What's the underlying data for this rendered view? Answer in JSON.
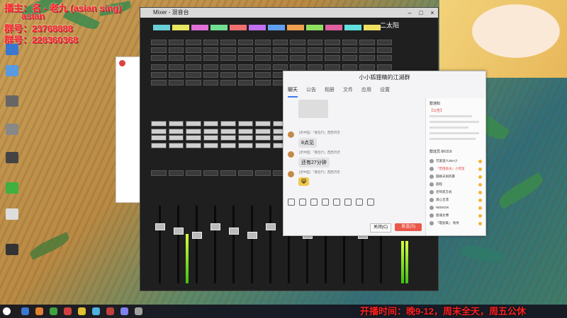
{
  "overlay": {
    "line1": "播主：名 - 老九 (asian sing)",
    "line2": "asian",
    "line3": "群号：23768888",
    "line4": "群号：228360368",
    "bottom": "开播时间：晚9-12，周末全天，周五公休"
  },
  "mixer": {
    "title": "Mixer - 混音台",
    "window_label": "二太阳",
    "tab_colors": [
      "#6ad0d8",
      "#e8e860",
      "#e070d8",
      "#70e090",
      "#f07070",
      "#c070f0",
      "#60a0f0",
      "#f0a050",
      "#90e060",
      "#e060a0",
      "#60e0e0",
      "#f0e060"
    ]
  },
  "chat": {
    "title": "小小狐狸精的江湖群",
    "tabs": [
      "聊天",
      "公告",
      "相册",
      "文件",
      "应用",
      "设置"
    ],
    "messages": [
      {
        "name": "[老中医] 「重俭行」西西河老",
        "text": "8点见"
      },
      {
        "name": "[老中医] 「重俭行」西西河老",
        "text": "还有27分钟"
      },
      {
        "name": "[老中医] 「重俭行」西西河老",
        "text": "😸"
      }
    ],
    "buttons": {
      "close": "关闭(C)",
      "send": "发送(S)"
    },
    "side": {
      "notice_title": "群通知",
      "notice_line1": "【公告】",
      "members_label": "群成员 86/316",
      "members": [
        "可爱迷人36A小",
        "「范围会员」小老鼠",
        "圆格天如风暴",
        "旅程",
        "老师黑方式",
        "演心吉凛",
        "NEEKDK",
        "窗城太傅",
        "「靠别来」 青卅"
      ]
    }
  },
  "taskbar": {
    "icons": [
      "#3a78d0",
      "#e08030",
      "#40a040",
      "#d04040",
      "#e0c030",
      "#50b0e0",
      "#c04040",
      "#8080f0",
      "#a0a0a0"
    ]
  }
}
